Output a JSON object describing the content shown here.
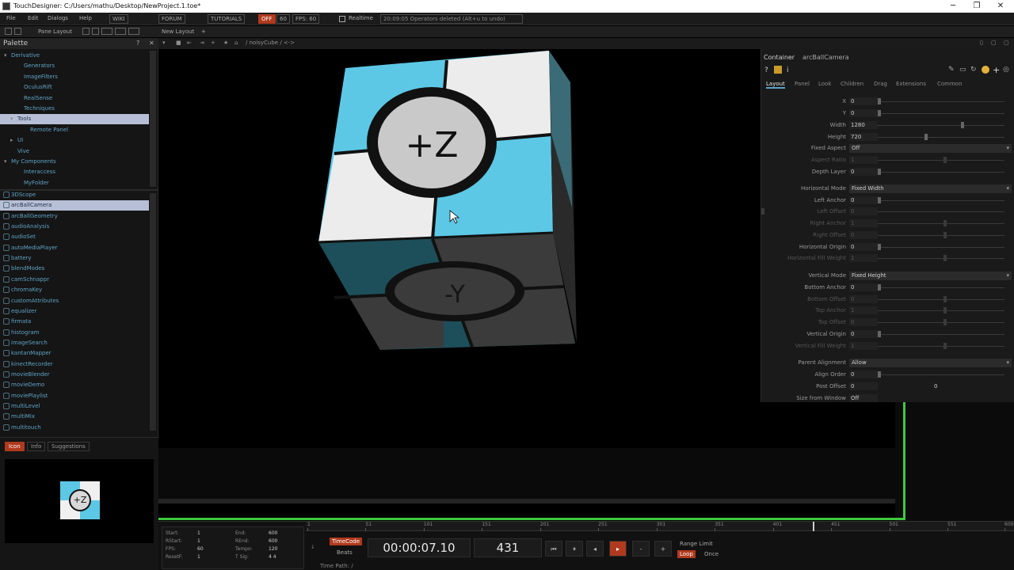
{
  "window": {
    "title": "TouchDesigner: C:/Users/mathu/Desktop/NewProject.1.toe*",
    "minimize": "─",
    "maximize": "❐",
    "close": "✕"
  },
  "menubar": {
    "items": [
      "File",
      "Edit",
      "Dialogs",
      "Help"
    ],
    "wiki": "WIKI",
    "forum": "FORUM",
    "tutorials": "TUTORIALS",
    "off": "OFF",
    "num": "60",
    "fps": "FPS: 60",
    "realtime": "Realtime",
    "status": "20:09:05 Operators deleted (Alt+u to undo)"
  },
  "panebar": {
    "pane_layout": "Pane Layout",
    "new_layout": "New Layout"
  },
  "palette": {
    "title": "Palette",
    "tree": [
      {
        "label": "Derivative",
        "indent": 0,
        "arrow": "▾",
        "selected": false
      },
      {
        "label": "Generators",
        "indent": 2,
        "arrow": "",
        "selected": false
      },
      {
        "label": "ImageFilters",
        "indent": 2,
        "arrow": "",
        "selected": false
      },
      {
        "label": "OculusRift",
        "indent": 2,
        "arrow": "",
        "selected": false
      },
      {
        "label": "RealSense",
        "indent": 2,
        "arrow": "",
        "selected": false
      },
      {
        "label": "Techniques",
        "indent": 2,
        "arrow": "",
        "selected": false
      },
      {
        "label": "Tools",
        "indent": 1,
        "arrow": "▾",
        "selected": true
      },
      {
        "label": "Remote Panel",
        "indent": 3,
        "arrow": "",
        "selected": false
      },
      {
        "label": "UI",
        "indent": 1,
        "arrow": "▸",
        "selected": false
      },
      {
        "label": "Vive",
        "indent": 1,
        "arrow": "",
        "selected": false
      },
      {
        "label": "My Components",
        "indent": 0,
        "arrow": "▾",
        "selected": false
      },
      {
        "label": "Interaccess",
        "indent": 2,
        "arrow": "",
        "selected": false
      },
      {
        "label": "MyFolder",
        "indent": 2,
        "arrow": "",
        "selected": false
      }
    ],
    "components": [
      "3DScope",
      "arcBallCamera",
      "arcBallGeometry",
      "audioAnalysis",
      "audioSet",
      "autoMediaPlayer",
      "battery",
      "blendModes",
      "camSchnappr",
      "chromaKey",
      "customAttributes",
      "equalizer",
      "firmata",
      "histogram",
      "imageSearch",
      "kantanMapper",
      "kinectRecorder",
      "movieBlender",
      "movieDemo",
      "moviePlaylist",
      "multiLevel",
      "multiMix",
      "multitouch"
    ],
    "selected_component": "arcBallCamera"
  },
  "preview": {
    "tabs": [
      "Icon",
      "Info",
      "Suggestions"
    ],
    "active_tab": "Icon",
    "thumb_label": "+Z"
  },
  "network": {
    "path": "/ noisyCube / <->"
  },
  "viewport": {
    "top_face": "+Z",
    "front_face": "-Y",
    "colors": {
      "cyan": "#5cc8e6",
      "white": "#ececec",
      "teal": "#1d4f5a",
      "gray": "#3b3b3b",
      "disc": "#c9c9c9"
    }
  },
  "params": {
    "header_type": "Container",
    "header_name": "arcBallCamera",
    "tabs": [
      "Layout",
      "Panel",
      "Look",
      "Children",
      "Drag",
      "Extensions",
      "Common"
    ],
    "active_tab": "Layout",
    "rows": [
      {
        "label": "X",
        "value": "0",
        "kind": "field",
        "dim": false
      },
      {
        "label": "Y",
        "value": "0",
        "kind": "field",
        "dim": false
      },
      {
        "label": "Width",
        "value": "1280",
        "kind": "field",
        "dim": false
      },
      {
        "label": "Height",
        "value": "720",
        "kind": "field",
        "dim": false
      },
      {
        "label": "Fixed Aspect",
        "value": "Off",
        "kind": "menu",
        "dim": false
      },
      {
        "label": "Aspect Ratio",
        "value": "1",
        "kind": "field",
        "dim": true
      },
      {
        "label": "Depth Layer",
        "value": "0",
        "kind": "field",
        "dim": false
      },
      {
        "label": "Horizontal Mode",
        "value": "Fixed Width",
        "kind": "menu",
        "dim": false
      },
      {
        "label": "Left Anchor",
        "value": "0",
        "kind": "field",
        "dim": false
      },
      {
        "label": "Left Offset",
        "value": "0",
        "kind": "field",
        "dim": true
      },
      {
        "label": "Right Anchor",
        "value": "1",
        "kind": "field",
        "dim": true
      },
      {
        "label": "Right Offset",
        "value": "0",
        "kind": "field",
        "dim": true
      },
      {
        "label": "Horizontal Origin",
        "value": "0",
        "kind": "field",
        "dim": false
      },
      {
        "label": "Horizontal Fill Weight",
        "value": "1",
        "kind": "field",
        "dim": true
      },
      {
        "label": "Vertical Mode",
        "value": "Fixed Height",
        "kind": "menu",
        "dim": false
      },
      {
        "label": "Bottom Anchor",
        "value": "0",
        "kind": "field",
        "dim": false
      },
      {
        "label": "Bottom Offset",
        "value": "0",
        "kind": "field",
        "dim": true
      },
      {
        "label": "Top Anchor",
        "value": "1",
        "kind": "field",
        "dim": true
      },
      {
        "label": "Top Offset",
        "value": "0",
        "kind": "field",
        "dim": true
      },
      {
        "label": "Vertical Origin",
        "value": "0",
        "kind": "field",
        "dim": false
      },
      {
        "label": "Vertical Fill Weight",
        "value": "1",
        "kind": "field",
        "dim": true
      },
      {
        "label": "Parent Alignment",
        "value": "Allow",
        "kind": "menu",
        "dim": false
      },
      {
        "label": "Align Order",
        "value": "0",
        "kind": "field",
        "dim": false
      },
      {
        "label": "Post Offset",
        "value": "0",
        "kind": "field",
        "dim": false
      },
      {
        "label": "Size from Window",
        "value": "Off",
        "kind": "field",
        "dim": false
      }
    ],
    "post_offset_second": "0"
  },
  "timeline": {
    "start_label": "Start:",
    "start": "1",
    "rstart_label": "RStart:",
    "rstart": "1",
    "fps_label": "FPS:",
    "fps": "60",
    "resetf_label": "ResetF:",
    "resetf": "1",
    "end_label": "End:",
    "end": "600",
    "rend_label": "REnd:",
    "rend": "600",
    "tempo_label": "Tempo:",
    "tempo": "120",
    "tsig_label": "T Sig:",
    "tsig": "4  4",
    "timecode_btn": "TimeCode",
    "beats_btn": "Beats",
    "timecode": "00:00:07.10",
    "frame": "431",
    "range_limit": "Range Limit",
    "loop_btn": "Loop",
    "once_btn": "Once",
    "time_path": "Time Path: /",
    "ruler": [
      "1",
      "51",
      "101",
      "151",
      "201",
      "251",
      "301",
      "351",
      "401",
      "451",
      "501",
      "551",
      "600"
    ]
  }
}
